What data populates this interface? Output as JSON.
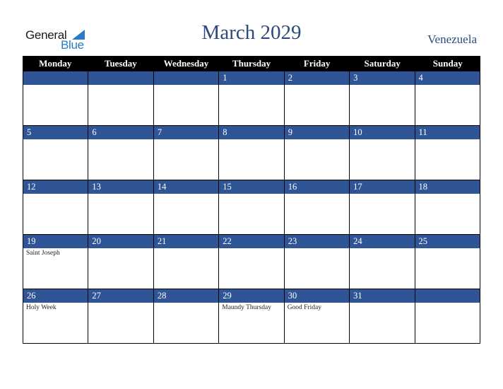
{
  "logo": {
    "word1": "General",
    "word2": "Blue"
  },
  "title": "March 2029",
  "country": "Venezuela",
  "colors": {
    "header_bg": "#000000",
    "date_band": "#2f5597",
    "title": "#2c4a7a",
    "logo_blue": "#2a7bc0"
  },
  "weekdays": [
    "Monday",
    "Tuesday",
    "Wednesday",
    "Thursday",
    "Friday",
    "Saturday",
    "Sunday"
  ],
  "weeks": [
    [
      {
        "day": "",
        "event": ""
      },
      {
        "day": "",
        "event": ""
      },
      {
        "day": "",
        "event": ""
      },
      {
        "day": "1",
        "event": ""
      },
      {
        "day": "2",
        "event": ""
      },
      {
        "day": "3",
        "event": ""
      },
      {
        "day": "4",
        "event": ""
      }
    ],
    [
      {
        "day": "5",
        "event": ""
      },
      {
        "day": "6",
        "event": ""
      },
      {
        "day": "7",
        "event": ""
      },
      {
        "day": "8",
        "event": ""
      },
      {
        "day": "9",
        "event": ""
      },
      {
        "day": "10",
        "event": ""
      },
      {
        "day": "11",
        "event": ""
      }
    ],
    [
      {
        "day": "12",
        "event": ""
      },
      {
        "day": "13",
        "event": ""
      },
      {
        "day": "14",
        "event": ""
      },
      {
        "day": "15",
        "event": ""
      },
      {
        "day": "16",
        "event": ""
      },
      {
        "day": "17",
        "event": ""
      },
      {
        "day": "18",
        "event": ""
      }
    ],
    [
      {
        "day": "19",
        "event": "Saint Joseph"
      },
      {
        "day": "20",
        "event": ""
      },
      {
        "day": "21",
        "event": ""
      },
      {
        "day": "22",
        "event": ""
      },
      {
        "day": "23",
        "event": ""
      },
      {
        "day": "24",
        "event": ""
      },
      {
        "day": "25",
        "event": ""
      }
    ],
    [
      {
        "day": "26",
        "event": "Holy Week"
      },
      {
        "day": "27",
        "event": ""
      },
      {
        "day": "28",
        "event": ""
      },
      {
        "day": "29",
        "event": "Maundy Thursday"
      },
      {
        "day": "30",
        "event": "Good Friday"
      },
      {
        "day": "31",
        "event": ""
      },
      {
        "day": "",
        "event": ""
      }
    ]
  ]
}
